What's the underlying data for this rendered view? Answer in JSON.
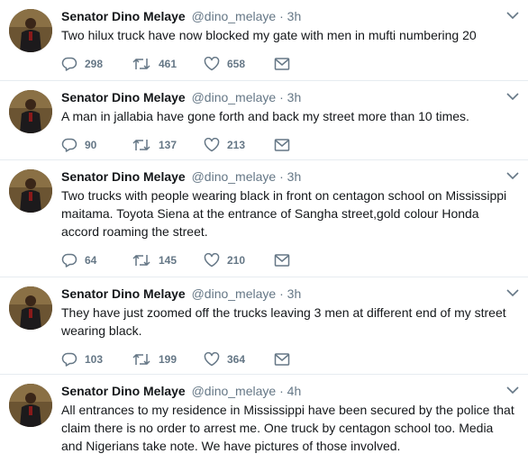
{
  "tweets": [
    {
      "name": "Senator Dino Melaye",
      "handle": "@dino_melaye",
      "separator": "·",
      "time": "3h",
      "text": "Two hilux truck have now blocked my gate with men in mufti numbering 20",
      "replies": "298",
      "retweets": "461",
      "likes": "658"
    },
    {
      "name": "Senator Dino Melaye",
      "handle": "@dino_melaye",
      "separator": "·",
      "time": "3h",
      "text": "A man in jallabia have gone forth and back my street more than 10 times.",
      "replies": "90",
      "retweets": "137",
      "likes": "213"
    },
    {
      "name": "Senator Dino Melaye",
      "handle": "@dino_melaye",
      "separator": "·",
      "time": "3h",
      "text": "Two trucks with people wearing black in front on centagon school on Mississippi maitama. Toyota Siena at the entrance of Sangha street,gold colour Honda accord roaming the street.",
      "replies": "64",
      "retweets": "145",
      "likes": "210"
    },
    {
      "name": "Senator Dino Melaye",
      "handle": "@dino_melaye",
      "separator": "·",
      "time": "3h",
      "text": "They have just zoomed off the trucks leaving 3 men at different end of my street wearing black.",
      "replies": "103",
      "retweets": "199",
      "likes": "364"
    },
    {
      "name": "Senator Dino Melaye",
      "handle": "@dino_melaye",
      "separator": "·",
      "time": "4h",
      "text": "All entrances to my residence in Mississippi have been secured by the police that claim there is no order to arrest me. One truck by centagon school too. Media and Nigerians take note. We have pictures of those involved.",
      "replies": "",
      "retweets": "",
      "likes": ""
    }
  ],
  "icons": {
    "reply": "reply-icon",
    "retweet": "retweet-icon",
    "like": "heart-icon",
    "message": "envelope-icon",
    "more": "chevron-down-icon"
  },
  "colors": {
    "text": "#14171a",
    "secondary": "#657786",
    "divider": "#e6ecf0"
  }
}
